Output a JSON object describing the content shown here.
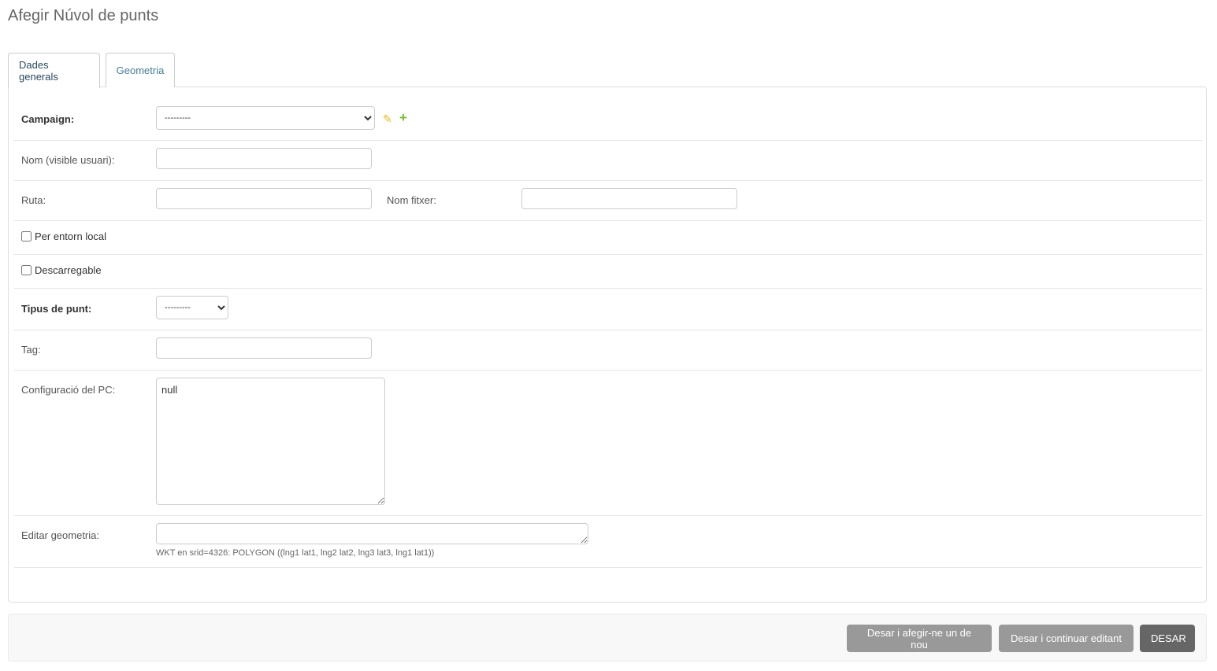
{
  "page": {
    "title": "Afegir Núvol de punts"
  },
  "tabs": [
    {
      "label": "Dades generals",
      "active": true
    },
    {
      "label": "Geometria",
      "active": false
    }
  ],
  "form": {
    "campaign": {
      "label": "Campaign:",
      "selected": "---------",
      "edit_icon": "pencil-icon",
      "add_icon": "plus-icon"
    },
    "nom": {
      "label": "Nom (visible usuari):",
      "value": ""
    },
    "ruta": {
      "label": "Ruta:",
      "value": ""
    },
    "nom_fitxer": {
      "label": "Nom fitxer:",
      "value": ""
    },
    "per_entorn_local": {
      "label": "Per entorn local",
      "checked": false
    },
    "descarregable": {
      "label": "Descarregable",
      "checked": false
    },
    "tipus_punt": {
      "label": "Tipus de punt:",
      "selected": "---------"
    },
    "tag": {
      "label": "Tag:",
      "value": ""
    },
    "config_pc": {
      "label": "Configuració del PC:",
      "value": "null"
    },
    "editar_geometria": {
      "label": "Editar geometria:",
      "value": "",
      "help": "WKT en srid=4326: POLYGON ((lng1 lat1, lng2 lat2, lng3 lat3, lng1 lat1))"
    }
  },
  "actions": {
    "save_add": "Desar i afegir-ne un de nou",
    "save_continue": "Desar i continuar editant",
    "save": "DESAR"
  },
  "colors": {
    "link": "#447e9b",
    "pencil": "#efb80b",
    "plus": "#70bf2b",
    "button": "#999999",
    "button_default": "#666666"
  }
}
